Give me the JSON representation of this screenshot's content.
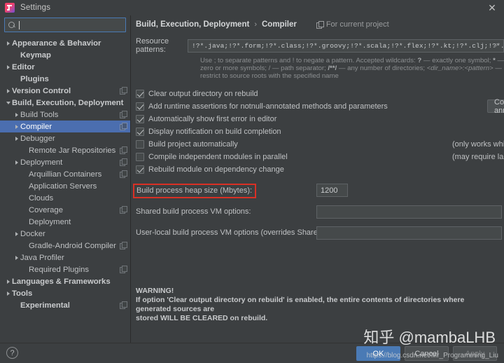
{
  "window": {
    "title": "Settings",
    "app_icon": "intellij-idea-icon",
    "close_label": "✕"
  },
  "search": {
    "placeholder": "",
    "value": "",
    "icon": "search-icon"
  },
  "sidebar": {
    "items": [
      {
        "label": "Appearance & Behavior",
        "arrow": "right",
        "indent": 0,
        "bold": true,
        "badge": false,
        "selected": false
      },
      {
        "label": "Keymap",
        "arrow": "none",
        "indent": 1,
        "bold": true,
        "badge": false,
        "selected": false
      },
      {
        "label": "Editor",
        "arrow": "right",
        "indent": 0,
        "bold": true,
        "badge": false,
        "selected": false
      },
      {
        "label": "Plugins",
        "arrow": "none",
        "indent": 1,
        "bold": true,
        "badge": false,
        "selected": false
      },
      {
        "label": "Version Control",
        "arrow": "right",
        "indent": 0,
        "bold": true,
        "badge": true,
        "selected": false
      },
      {
        "label": "Build, Execution, Deployment",
        "arrow": "down",
        "indent": 0,
        "bold": true,
        "badge": false,
        "selected": false
      },
      {
        "label": "Build Tools",
        "arrow": "right",
        "indent": 1,
        "bold": false,
        "badge": true,
        "selected": false
      },
      {
        "label": "Compiler",
        "arrow": "right",
        "indent": 1,
        "bold": false,
        "badge": true,
        "selected": true
      },
      {
        "label": "Debugger",
        "arrow": "right",
        "indent": 1,
        "bold": false,
        "badge": false,
        "selected": false
      },
      {
        "label": "Remote Jar Repositories",
        "arrow": "none",
        "indent": 2,
        "bold": false,
        "badge": true,
        "selected": false
      },
      {
        "label": "Deployment",
        "arrow": "right",
        "indent": 1,
        "bold": false,
        "badge": true,
        "selected": false
      },
      {
        "label": "Arquillian Containers",
        "arrow": "none",
        "indent": 2,
        "bold": false,
        "badge": true,
        "selected": false
      },
      {
        "label": "Application Servers",
        "arrow": "none",
        "indent": 2,
        "bold": false,
        "badge": false,
        "selected": false
      },
      {
        "label": "Clouds",
        "arrow": "none",
        "indent": 2,
        "bold": false,
        "badge": false,
        "selected": false
      },
      {
        "label": "Coverage",
        "arrow": "none",
        "indent": 2,
        "bold": false,
        "badge": true,
        "selected": false
      },
      {
        "label": "Deployment",
        "arrow": "none",
        "indent": 2,
        "bold": false,
        "badge": false,
        "selected": false
      },
      {
        "label": "Docker",
        "arrow": "right",
        "indent": 1,
        "bold": false,
        "badge": false,
        "selected": false
      },
      {
        "label": "Gradle-Android Compiler",
        "arrow": "none",
        "indent": 2,
        "bold": false,
        "badge": true,
        "selected": false
      },
      {
        "label": "Java Profiler",
        "arrow": "right",
        "indent": 1,
        "bold": false,
        "badge": false,
        "selected": false
      },
      {
        "label": "Required Plugins",
        "arrow": "none",
        "indent": 2,
        "bold": false,
        "badge": true,
        "selected": false
      },
      {
        "label": "Languages & Frameworks",
        "arrow": "right",
        "indent": 0,
        "bold": true,
        "badge": false,
        "selected": false
      },
      {
        "label": "Tools",
        "arrow": "right",
        "indent": 0,
        "bold": true,
        "badge": false,
        "selected": false
      },
      {
        "label": "Experimental",
        "arrow": "none",
        "indent": 1,
        "bold": true,
        "badge": true,
        "selected": false
      }
    ]
  },
  "main": {
    "breadcrumb": {
      "parent": "Build, Execution, Deployment",
      "separator": "›",
      "current": "Compiler"
    },
    "for_current_project": "For current project",
    "resource_patterns": {
      "label": "Resource patterns:",
      "value": "!?*.java;!?*.form;!?*.class;!?*.groovy;!?*.scala;!?*.flex;!?*.kt;!?*.clj;!?*.aj",
      "expand_icon": "expand-arrow-icon",
      "hint_line1_a": "Use ; to separate patterns and ! to negate a pattern. Accepted wildcards: ",
      "hint_q": "?",
      "hint_line1_b": " — exactly one symbol; ",
      "hint_star": "*",
      "hint_line1_c": " — zero or more",
      "hint_line2_a": "symbols; / — path separator; ",
      "hint_slashstar": "/**/",
      "hint_line2_b": " — any number of directories;  ",
      "hint_dirname": "<dir_name>:<pattern>",
      "hint_line2_c": " — restrict to source roots with the",
      "hint_line3": "specified name"
    },
    "checkboxes": [
      {
        "label": "Clear output directory on rebuild",
        "checked": true,
        "note": ""
      },
      {
        "label": "Add runtime assertions for notnull-annotated methods and parameters",
        "checked": true,
        "note": ""
      },
      {
        "label": "Automatically show first error in editor",
        "checked": true,
        "note": ""
      },
      {
        "label": "Display notification on build completion",
        "checked": true,
        "note": ""
      },
      {
        "label": "Build project automatically",
        "checked": false,
        "note": "(only works while not running / debugging)"
      },
      {
        "label": "Compile independent modules in parallel",
        "checked": false,
        "note": "(may require larger heap size)"
      },
      {
        "label": "Rebuild module on dependency change",
        "checked": true,
        "note": ""
      }
    ],
    "configure_annotations_button": "Configure annotations...",
    "heap": {
      "label": "Build process heap size (Mbytes):",
      "value": "1200",
      "highlight_color": "#d93025"
    },
    "shared_vm": {
      "label": "Shared build process VM options:",
      "value": ""
    },
    "userlocal_vm": {
      "label": "User-local build process VM options (overrides Shared options):",
      "value": ""
    },
    "warning": {
      "title": "WARNING!",
      "line1": "If option 'Clear output directory on rebuild' is enabled, the entire contents of directories where generated sources are",
      "line2": "stored WILL BE CLEARED on rebuild."
    }
  },
  "footer": {
    "help_label": "?",
    "ok": "OK",
    "cancel": "Cancel",
    "apply": "Apply"
  },
  "watermark": {
    "zhihu": "知乎 @mambaLHB",
    "url": "https://blog.csdn.net/Mr_Programming_Liu"
  }
}
